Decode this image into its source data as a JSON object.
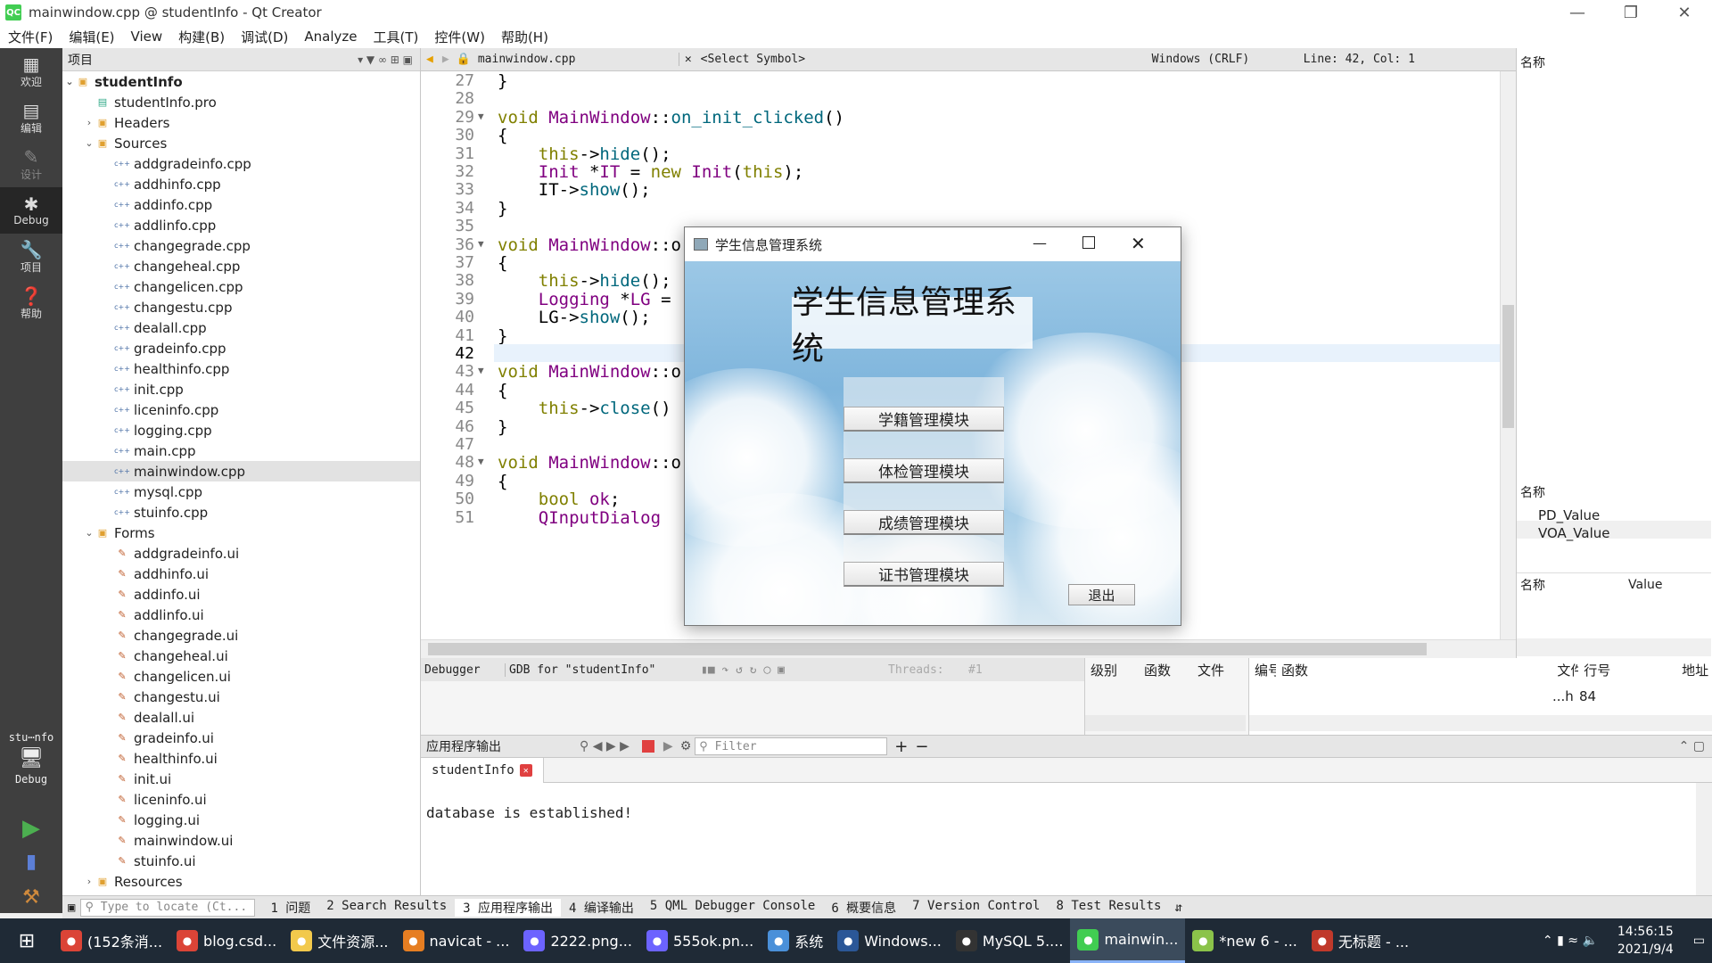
{
  "window": {
    "title": "mainwindow.cpp @ studentInfo - Qt Creator",
    "app_icon": "QC"
  },
  "menu": [
    "文件(F)",
    "编辑(E)",
    "View",
    "构建(B)",
    "调试(D)",
    "Analyze",
    "工具(T)",
    "控件(W)",
    "帮助(H)"
  ],
  "modes": [
    {
      "label": "欢迎",
      "icon": "grid-icon"
    },
    {
      "label": "编辑",
      "icon": "document-icon"
    },
    {
      "label": "设计",
      "icon": "pencil-icon"
    },
    {
      "label": "Debug",
      "icon": "bug-icon"
    },
    {
      "label": "项目",
      "icon": "wrench-icon"
    },
    {
      "label": "帮助",
      "icon": "help-icon"
    }
  ],
  "kit": {
    "name": "stu⋯nfo",
    "mode": "Debug"
  },
  "project_pane": {
    "title": "项目",
    "root": "studentInfo",
    "pro_file": "studentInfo.pro",
    "headers": "Headers",
    "sources": "Sources",
    "source_files": [
      "addgradeinfo.cpp",
      "addhinfo.cpp",
      "addinfo.cpp",
      "addlinfo.cpp",
      "changegrade.cpp",
      "changeheal.cpp",
      "changelicen.cpp",
      "changestu.cpp",
      "dealall.cpp",
      "gradeinfo.cpp",
      "healthinfo.cpp",
      "init.cpp",
      "liceninfo.cpp",
      "logging.cpp",
      "main.cpp",
      "mainwindow.cpp",
      "mysql.cpp",
      "stuinfo.cpp"
    ],
    "forms": "Forms",
    "form_files": [
      "addgradeinfo.ui",
      "addhinfo.ui",
      "addinfo.ui",
      "addlinfo.ui",
      "changegrade.ui",
      "changeheal.ui",
      "changelicen.ui",
      "changestu.ui",
      "dealall.ui",
      "gradeinfo.ui",
      "healthinfo.ui",
      "init.ui",
      "liceninfo.ui",
      "logging.ui",
      "mainwindow.ui",
      "stuinfo.ui"
    ],
    "resources": "Resources"
  },
  "editor_bar": {
    "file": "mainwindow.cpp",
    "symbol": "<Select Symbol>",
    "encoding": "Windows (CRLF)",
    "position": "Line: 42, Col: 1"
  },
  "code_lines": [
    {
      "n": "27",
      "t": "}"
    },
    {
      "n": "28",
      "t": ""
    },
    {
      "n": "29",
      "t": "void MainWindow::on_init_clicked()"
    },
    {
      "n": "30",
      "t": "{"
    },
    {
      "n": "31",
      "t": "    this->hide();"
    },
    {
      "n": "32",
      "t": "    Init *IT = new Init(this);"
    },
    {
      "n": "33",
      "t": "    IT->show();"
    },
    {
      "n": "34",
      "t": "}"
    },
    {
      "n": "35",
      "t": ""
    },
    {
      "n": "36",
      "t": "void MainWindow::o"
    },
    {
      "n": "37",
      "t": "{"
    },
    {
      "n": "38",
      "t": "    this->hide();"
    },
    {
      "n": "39",
      "t": "    Logging *LG ="
    },
    {
      "n": "40",
      "t": "    LG->show();"
    },
    {
      "n": "41",
      "t": "}"
    },
    {
      "n": "42",
      "t": ""
    },
    {
      "n": "43",
      "t": "void MainWindow::o"
    },
    {
      "n": "44",
      "t": "{"
    },
    {
      "n": "45",
      "t": "    this->close()"
    },
    {
      "n": "46",
      "t": "}"
    },
    {
      "n": "47",
      "t": ""
    },
    {
      "n": "48",
      "t": "void MainWindow::o"
    },
    {
      "n": "49",
      "t": "{"
    },
    {
      "n": "50",
      "t": "    bool ok;"
    },
    {
      "n": "51",
      "t": "    QInputDialog"
    }
  ],
  "right_pane": {
    "header1": "名称",
    "header2": "名称",
    "items": [
      "PD_Value",
      "VOA_Value"
    ],
    "col_name": "名称",
    "col_value": "Value"
  },
  "dialog": {
    "title": "学生信息管理系统",
    "heading": "学生信息管理系统",
    "buttons": [
      "学籍管理模块",
      "体检管理模块",
      "成绩管理模块",
      "证书管理模块"
    ],
    "exit": "退出"
  },
  "debugger": {
    "label": "Debugger",
    "gdb": "GDB for \"studentInfo\"",
    "threads": "Threads:",
    "thread_num": "#1",
    "cols1": [
      "级别",
      "函数",
      "文件"
    ],
    "cols2": [
      "编号",
      "函数",
      "文件",
      "行号",
      "地址"
    ],
    "row_file": "...h",
    "row_line": "84"
  },
  "output": {
    "title": "应用程序输出",
    "filter_placeholder": "Filter",
    "tab": "studentInfo",
    "text": "database is established!"
  },
  "statusbar": {
    "locate_placeholder": "Type to locate (Ct...",
    "tabs": [
      "1 问题",
      "2 Search Results",
      "3 应用程序输出",
      "4 编译输出",
      "5 QML Debugger Console",
      "6 概要信息",
      "7 Version Control",
      "8 Test Results"
    ]
  },
  "taskbar": {
    "items": [
      {
        "label": "(152条消...",
        "icon": "chrome-icon",
        "color": "#db4437"
      },
      {
        "label": "blog.csd...",
        "icon": "chrome-icon",
        "color": "#db4437"
      },
      {
        "label": "文件资源...",
        "icon": "folder-icon",
        "color": "#f2c94c"
      },
      {
        "label": "navicat - ...",
        "icon": "navicat-icon",
        "color": "#e67e22"
      },
      {
        "label": "2222.png...",
        "icon": "image-icon",
        "color": "#6c63ff"
      },
      {
        "label": "555ok.pn...",
        "icon": "image-icon",
        "color": "#6c63ff"
      },
      {
        "label": "系统",
        "icon": "system-icon",
        "color": "#4a90d9"
      },
      {
        "label": "Windows...",
        "icon": "powershell-icon",
        "color": "#2b5797"
      },
      {
        "label": "MySQL 5....",
        "icon": "mysql-icon",
        "color": "#333333"
      },
      {
        "label": "mainwin...",
        "icon": "qt-icon",
        "color": "#41cd52"
      },
      {
        "label": "*new 6 - ...",
        "icon": "notepad-icon",
        "color": "#8bc34a"
      },
      {
        "label": "无标题 - ...",
        "icon": "paint-icon",
        "color": "#c0392b"
      }
    ],
    "time": "14:56:15",
    "date": "2021/9/4"
  }
}
